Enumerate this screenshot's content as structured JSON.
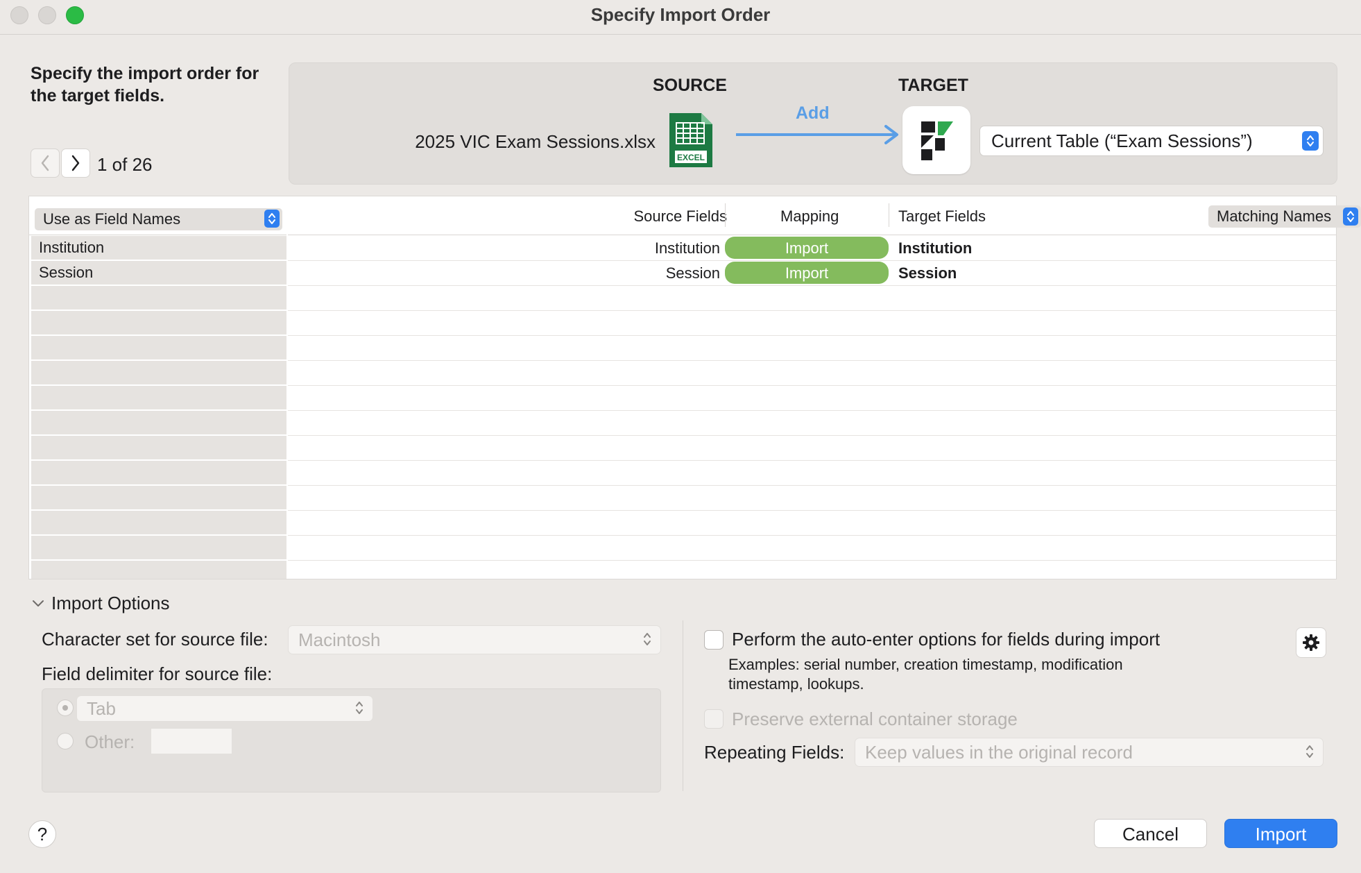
{
  "window": {
    "title": "Specify Import Order"
  },
  "instruction": "Specify the import order for the target fields.",
  "navigation": {
    "counter": "1 of 26"
  },
  "source": {
    "heading": "SOURCE",
    "file_name": "2025 VIC Exam Sessions.xlsx",
    "icon": "excel-icon",
    "icon_label": "EXCEL"
  },
  "mapping_arrow": {
    "label": "Add"
  },
  "target": {
    "heading": "TARGET",
    "table_select": "Current Table (“Exam Sessions”)",
    "icon": "filemaker-icon"
  },
  "table": {
    "field_names_select": "Use as Field Names",
    "columns": {
      "source": "Source Fields",
      "mapping": "Mapping",
      "target": "Target Fields"
    },
    "match_select": "Matching Names",
    "rows": [
      {
        "left": "Institution",
        "source": "Institution",
        "mapping": "Import",
        "target": "Institution"
      },
      {
        "left": "Session",
        "source": "Session",
        "mapping": "Import",
        "target": "Session"
      }
    ]
  },
  "import_options": {
    "toggle_label": "Import Options",
    "charset_label": "Character set for source file:",
    "charset_value": "Macintosh",
    "delimiter_label": "Field delimiter for source file:",
    "delimiter_tab": "Tab",
    "delimiter_other_label": "Other:",
    "auto_enter_label": "Perform the auto-enter options for fields during import",
    "auto_enter_examples": "Examples: serial number, creation timestamp, modification timestamp, lookups.",
    "preserve_label": "Preserve external container storage",
    "repeating_label": "Repeating Fields:",
    "repeating_value": "Keep values in the original record"
  },
  "buttons": {
    "help": "?",
    "cancel": "Cancel",
    "import": "Import"
  },
  "colors": {
    "accent": "#2f7ff0",
    "import_pill": "#84bb5d",
    "add_arrow": "#5a9ee6"
  }
}
